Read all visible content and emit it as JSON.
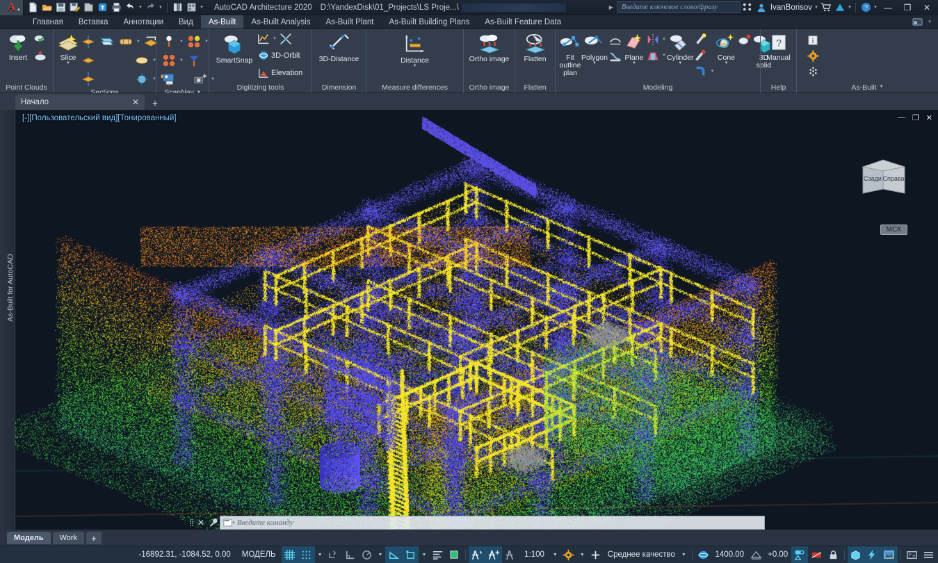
{
  "titlebar": {
    "app_title": "AutoCAD Architecture 2020",
    "document_path": "D:\\YandexDisk\\01_Projects\\LS Proje...\\",
    "search_placeholder": "Введите ключевое слово/фразу",
    "username": "IvanBorisov",
    "logo_letter": "A",
    "quick_access": [
      {
        "name": "new-file-icon",
        "label": "New"
      },
      {
        "name": "open-file-icon",
        "label": "Open"
      },
      {
        "name": "save-icon",
        "label": "Save"
      },
      {
        "name": "save-as-icon",
        "label": "Save As"
      },
      {
        "name": "export-icon",
        "label": "Export"
      },
      {
        "name": "cloud-sync-icon",
        "label": "Sync"
      },
      {
        "name": "print-icon",
        "label": "Plot"
      },
      {
        "name": "undo-icon",
        "label": "Undo"
      },
      {
        "name": "redo-icon",
        "label": "Redo"
      },
      {
        "name": "layer-properties-icon",
        "label": "Layers"
      },
      {
        "name": "workspace-icon",
        "label": "Workspace"
      },
      {
        "name": "qat-overflow-icon",
        "label": "Customize"
      }
    ],
    "right_icons": [
      {
        "name": "share-view-icon",
        "label": "Share"
      },
      {
        "name": "account-icon",
        "label": "Account"
      },
      {
        "name": "cart-icon",
        "label": "Autodesk App Store"
      },
      {
        "name": "autodesk-icon",
        "label": "Autodesk"
      },
      {
        "name": "help-icon",
        "label": "Help"
      }
    ],
    "window_buttons": {
      "minimize": "—",
      "maximize": "❐",
      "close": "✕"
    }
  },
  "ribbon_tabs": [
    {
      "label": "Главная",
      "active": false
    },
    {
      "label": "Вставка",
      "active": false
    },
    {
      "label": "Аннотации",
      "active": false
    },
    {
      "label": "Вид",
      "active": false
    },
    {
      "label": "As-Built",
      "active": true
    },
    {
      "label": "As-Built Analysis",
      "active": false
    },
    {
      "label": "As-Built Plant",
      "active": false
    },
    {
      "label": "As-Built Building Plans",
      "active": false
    },
    {
      "label": "As-Built Feature Data",
      "active": false
    }
  ],
  "ribbon_panels": [
    {
      "title": "Point Clouds",
      "buttons": [
        {
          "label": "Insert",
          "icon": "point-cloud-insert-icon",
          "type": "big"
        },
        {
          "label": "Attach point cloud",
          "icon": "point-cloud-attach-icon",
          "type": "small"
        },
        {
          "label": "Point cloud manager",
          "icon": "point-cloud-manager-icon",
          "type": "small"
        }
      ]
    },
    {
      "title": "Sections",
      "buttons": [
        {
          "label": "Slice",
          "icon": "slice-icon",
          "type": "big"
        },
        {
          "label": "Section horizontal",
          "icon": "section-horizontal-icon",
          "type": "small"
        },
        {
          "label": "Section vertical",
          "icon": "section-vertical-icon",
          "type": "small"
        },
        {
          "label": "Section both",
          "icon": "section-both-icon",
          "type": "small"
        },
        {
          "label": "Section box",
          "icon": "section-box-icon",
          "type": "small"
        },
        {
          "label": "Section slab",
          "icon": "section-slab-icon",
          "type": "small"
        },
        {
          "label": "Section move",
          "icon": "section-move-icon",
          "type": "small"
        },
        {
          "label": "Section settings",
          "icon": "section-settings-icon",
          "type": "small"
        },
        {
          "label": "Section clip",
          "icon": "section-clip-icon",
          "type": "small"
        }
      ]
    },
    {
      "title": "ScanNav",
      "has_dropdown": true,
      "buttons": [
        {
          "label": "Single point",
          "icon": "scan-point-icon",
          "type": "small"
        },
        {
          "label": "Point group",
          "icon": "scan-group-icon",
          "type": "small"
        },
        {
          "label": "Point cluster",
          "icon": "scan-cluster-icon",
          "type": "small"
        },
        {
          "label": "Scan position",
          "icon": "scan-position-icon",
          "type": "small"
        },
        {
          "label": "Scan image",
          "icon": "scan-image-icon",
          "type": "small"
        },
        {
          "label": "Scan camera",
          "icon": "scan-camera-icon",
          "type": "small"
        }
      ]
    },
    {
      "title": "Digitizing tools",
      "buttons": [
        {
          "label": "SmartSnap",
          "icon": "smartsnap-icon",
          "type": "big"
        },
        {
          "label": "3D-Orbit",
          "icon": "orbit-icon",
          "type": "text"
        },
        {
          "label": "Elevation",
          "icon": "elevation-icon",
          "type": "text"
        },
        {
          "label": "Chart tool",
          "icon": "chart-tool-icon",
          "type": "small"
        },
        {
          "label": "Cross tool",
          "icon": "cross-tool-icon",
          "type": "small"
        }
      ]
    },
    {
      "title": "Dimension",
      "buttons": [
        {
          "label": "3D-Distance",
          "icon": "distance-3d-icon",
          "type": "big"
        }
      ]
    },
    {
      "title": "Measure differences",
      "buttons": [
        {
          "label": "Distance",
          "icon": "measure-distance-icon",
          "type": "big",
          "has_dropdown": true
        }
      ]
    },
    {
      "title": "Ortho image",
      "buttons": [
        {
          "label": "Ortho image",
          "icon": "ortho-image-icon",
          "type": "big"
        }
      ]
    },
    {
      "title": "Flatten",
      "buttons": [
        {
          "label": "Flatten",
          "icon": "flatten-icon",
          "type": "big"
        }
      ]
    },
    {
      "title": "Modeling",
      "buttons": [
        {
          "label": "Fit outline plan",
          "icon": "fit-outline-plan-icon",
          "type": "big"
        },
        {
          "label": "Polygon",
          "icon": "polygon-icon",
          "type": "big",
          "has_dropdown": true
        },
        {
          "label": "Surface",
          "icon": "surface-icon",
          "type": "small"
        },
        {
          "label": "Profile",
          "icon": "profile-icon",
          "type": "small"
        },
        {
          "label": "Plane",
          "icon": "plane-icon",
          "type": "big",
          "has_dropdown": true
        },
        {
          "label": "Mirror plane",
          "icon": "mirror-plane-icon",
          "type": "small"
        },
        {
          "label": "Wall plane",
          "icon": "wall-plane-icon",
          "type": "small"
        },
        {
          "label": "Cylinder",
          "icon": "cylinder-icon",
          "type": "big",
          "has_dropdown": true
        },
        {
          "label": "Pipe",
          "icon": "pipe-icon",
          "type": "small"
        },
        {
          "label": "Nozzle",
          "icon": "nozzle-icon",
          "type": "small"
        },
        {
          "label": "Elbow",
          "icon": "elbow-icon",
          "type": "small"
        },
        {
          "label": "Cone",
          "icon": "cone-icon",
          "type": "big",
          "has_dropdown": true
        },
        {
          "label": "Torus",
          "icon": "torus-icon",
          "type": "small"
        },
        {
          "label": "3D solid",
          "icon": "solid-3d-icon",
          "type": "big"
        }
      ]
    },
    {
      "title": "Help",
      "buttons": [
        {
          "label": "Manual",
          "icon": "manual-icon",
          "type": "big"
        }
      ]
    },
    {
      "title": "As-Built",
      "has_dropdown": true,
      "buttons": [
        {
          "label": "Info",
          "icon": "info-icon",
          "type": "small"
        },
        {
          "label": "Settings",
          "icon": "settings-gear-icon",
          "type": "small"
        },
        {
          "label": "Point cloud tools",
          "icon": "point-tools-icon",
          "type": "small"
        }
      ]
    }
  ],
  "document_tabs": {
    "tabs": [
      {
        "label": "Начало",
        "close": "✕"
      }
    ],
    "new_tab": "+"
  },
  "viewport": {
    "label": "[-][Пользовательский вид][Тонированный]",
    "sidebar_vertical_text": "As-Built for AutoCAD",
    "window_controls": {
      "minimize": "—",
      "restore": "❐",
      "close": "✕"
    },
    "viewcube": {
      "face_left": "Сзади",
      "face_right": "Справа"
    },
    "ucs_label": "МСК",
    "content_description": "Colorized laser-scan point cloud of a multi-level industrial steel structure with yellow handrails, blue columns and beams"
  },
  "command_line": {
    "placeholder": "Введите команду",
    "close_icon": "✕",
    "customize_icon": "🔧"
  },
  "model_tabs": [
    {
      "label": "Модель",
      "active": true
    },
    {
      "label": "Work",
      "active": false
    },
    {
      "label": "+",
      "active": false
    }
  ],
  "status_bar": {
    "coordinates": "-16892.31, -1084.52, 0.00",
    "space_label": "МОДЕЛЬ",
    "scale": "1:100",
    "quality": "Среднее качество",
    "point_count": "1400.00",
    "elevation": "+0.00",
    "buttons": [
      {
        "name": "grid-display-button",
        "label": "Сетка",
        "on": true
      },
      {
        "name": "snap-mode-button",
        "label": "Шаг",
        "on": true
      },
      {
        "name": "infer-constraints-button",
        "label": "Зависимости",
        "on": false
      },
      {
        "name": "ortho-mode-button",
        "label": "Орто",
        "on": false
      },
      {
        "name": "polar-tracking-button",
        "label": "Полярное отслеживание",
        "on": false
      },
      {
        "name": "isometric-drafting-button",
        "label": "Изометрия",
        "on": true
      },
      {
        "name": "object-snap-button",
        "label": "Объектная привязка",
        "on": true
      },
      {
        "name": "annotation-scale-button",
        "label": "Масштаб аннотаций",
        "on": false
      },
      {
        "name": "selection-cycling-button",
        "label": "Выбор",
        "on": false
      },
      {
        "name": "annotation-visibility-button",
        "label": "Видимость аннотаций",
        "on": true
      },
      {
        "name": "autoscale-button",
        "label": "Автомасштаб",
        "on": true
      },
      {
        "name": "lock-ui-button",
        "label": "Блокировка",
        "on": false
      },
      {
        "name": "workspace-switch-button",
        "label": "Рабочее пространство",
        "on": false
      },
      {
        "name": "hardware-accel-button",
        "label": "Аппаратное ускорение",
        "on": true
      },
      {
        "name": "isolate-objects-button",
        "label": "Изоляция объектов",
        "on": true
      },
      {
        "name": "graphics-perf-button",
        "label": "Производительность",
        "on": true
      },
      {
        "name": "clean-screen-button",
        "label": "Весь экран",
        "on": false
      },
      {
        "name": "customization-button",
        "label": "Адаптация",
        "on": false
      }
    ]
  },
  "colors": {
    "accent": "#1f4d6b",
    "ribbon_bg": "#333d4b",
    "titlebar_bg": "#1d2633",
    "active_tab": "#3e4a5a",
    "canvas_bg": "#101826",
    "status_bg": "#22303f",
    "text": "#dde5ee",
    "highlight_cyan": "#2bb3e6"
  }
}
